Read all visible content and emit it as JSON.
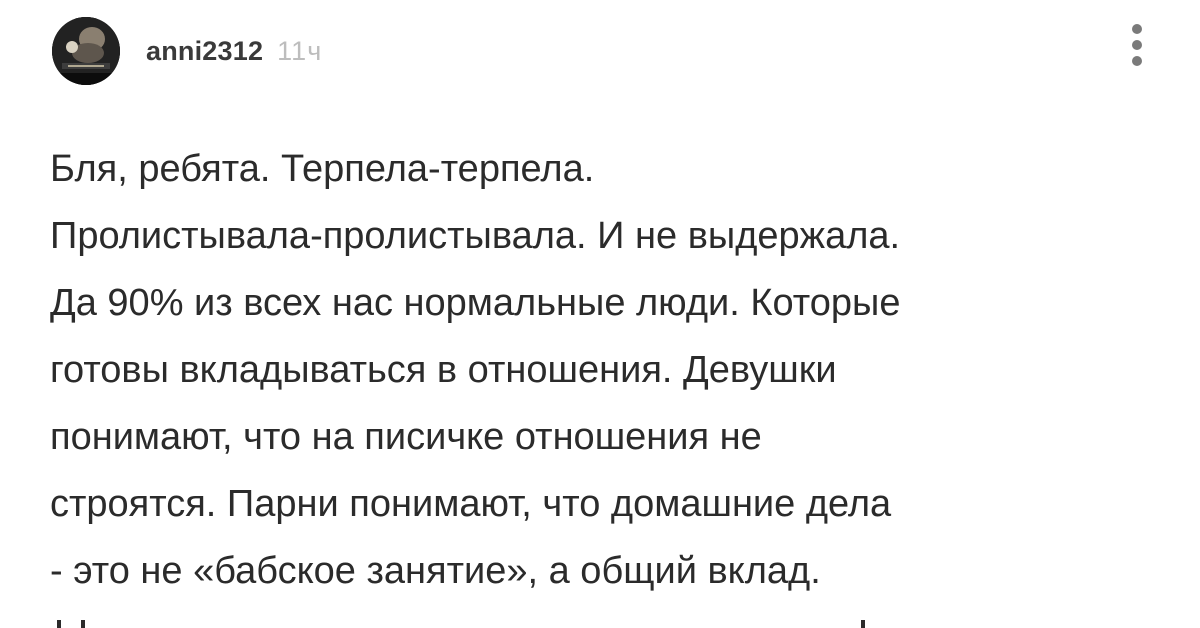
{
  "comment": {
    "author": {
      "username": "anni2312",
      "avatar_icon": "user-avatar-dark"
    },
    "timestamp": "11ч",
    "menu_icon": "more-vertical-icon",
    "body_lines": [
      "Бля, ребята. Терпела-терпела.",
      "Пролистывала-пролистывала. И не выдержала.",
      "Да 90% из всех нас нормальные люди. Которые",
      "готовы вкладываться в отношения. Девушки",
      "понимают, что на писичке отношения не",
      "строятся. Парни понимают, что домашние дела",
      "- это не «бабское занятие», а общий вклад."
    ]
  },
  "colors": {
    "text": "#2b2b2b",
    "username": "#3a3a3a",
    "timestamp": "#bdbdbd",
    "menu_dots": "#7a7a7a",
    "background": "#ffffff"
  }
}
